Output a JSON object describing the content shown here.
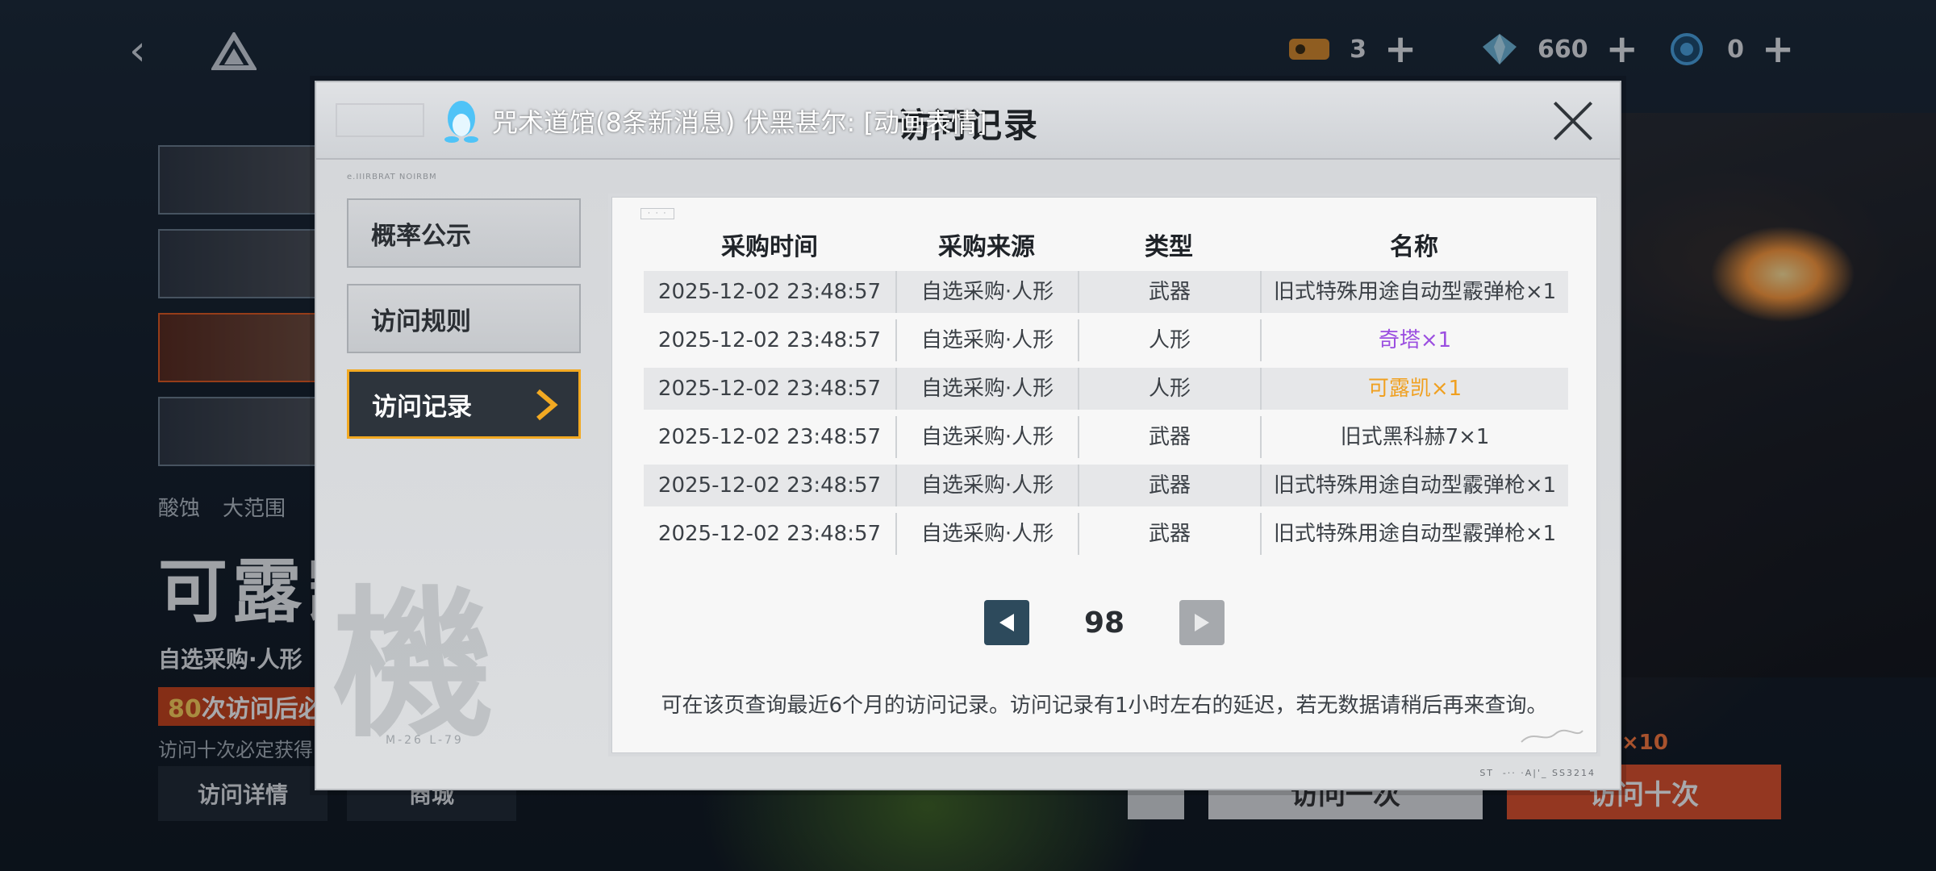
{
  "modal": {
    "title": "访问记录",
    "header_micro": "e.IIIRBRAT NOIRBM",
    "footer_micro": "ST-··  ·A|'_  SS3214",
    "nav": [
      {
        "label": "概率公示",
        "active": false
      },
      {
        "label": "访问规则",
        "active": false
      },
      {
        "label": "访问记录",
        "active": true
      }
    ],
    "kanji": "機",
    "kanji_sub": "M-26 L-79"
  },
  "notification": {
    "text": "咒术道馆(8条新消息) 伏黑甚尔: [动画表情]",
    "icon": "qq-penguin-icon"
  },
  "table": {
    "headers": [
      "采购时间",
      "采购来源",
      "类型",
      "名称"
    ],
    "rows": [
      {
        "time": "2025-12-02 23:48:57",
        "source": "自选采购·人形",
        "type": "武器",
        "name": "旧式特殊用途自动型霰弹枪×1",
        "name_color": "#3b4046"
      },
      {
        "time": "2025-12-02 23:48:57",
        "source": "自选采购·人形",
        "type": "人形",
        "name": "奇塔×1",
        "name_color": "#9b4ee0"
      },
      {
        "time": "2025-12-02 23:48:57",
        "source": "自选采购·人形",
        "type": "人形",
        "name": "可露凯×1",
        "name_color": "#f0a020"
      },
      {
        "time": "2025-12-02 23:48:57",
        "source": "自选采购·人形",
        "type": "武器",
        "name": "旧式黑科赫7×1",
        "name_color": "#3b4046"
      },
      {
        "time": "2025-12-02 23:48:57",
        "source": "自选采购·人形",
        "type": "武器",
        "name": "旧式特殊用途自动型霰弹枪×1",
        "name_color": "#3b4046"
      },
      {
        "time": "2025-12-02 23:48:57",
        "source": "自选采购·人形",
        "type": "武器",
        "name": "旧式特殊用途自动型霰弹枪×1",
        "name_color": "#3b4046"
      }
    ]
  },
  "pager": {
    "page": "98"
  },
  "footnote": "可在该页查询最近6个月的访问记录。访问记录有1小时左右的延迟，若无数据请稍后再来查询。",
  "resources": [
    {
      "icon": "ticket-icon",
      "value": "3",
      "color": "#d98a2a"
    },
    {
      "icon": "crystal-icon",
      "value": "660",
      "color": "#6fb7d9"
    },
    {
      "icon": "token-icon",
      "value": "0",
      "color": "#4aa3e0"
    }
  ],
  "background": {
    "tags": [
      "酸蚀",
      "大范围"
    ],
    "name": "可露凯",
    "sub": "自选采购·人形",
    "promo_num": "80",
    "promo_text": "次访问后必",
    "note": "访问十次必定获得",
    "buttons": {
      "detail": "访问详情",
      "shop": "商城",
      "once": "访问一次",
      "ten": "访问十次",
      "ten_cost": "×10"
    }
  },
  "colors": {
    "accent": "#f2a922",
    "nav_active_bg": "#2d343c",
    "pager_prev": "#2d4a5c",
    "pager_next": "#a6a9ad",
    "ten_button": "#e0512a"
  }
}
